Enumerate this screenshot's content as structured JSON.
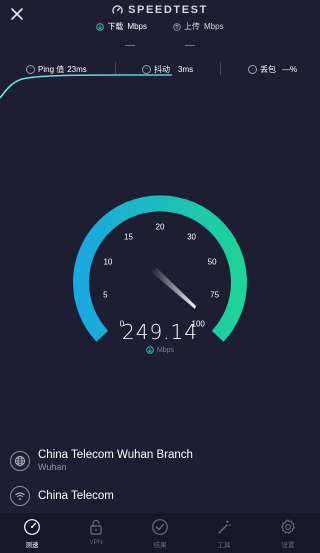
{
  "header": {
    "close_icon": "close-icon",
    "logo_text": "SPEEDTEST",
    "download_label": "下载",
    "download_unit": "Mbps",
    "upload_label": "上传",
    "upload_unit": "Mbps",
    "download_value": "—",
    "upload_value": "—"
  },
  "stats": {
    "ping_label": "Ping 值",
    "ping_value": "23ms",
    "jitter_label": "抖动",
    "jitter_value": "3ms",
    "loss_label": "丢包",
    "loss_value": "—%"
  },
  "gauge": {
    "ticks": [
      "0",
      "5",
      "10",
      "15",
      "20",
      "30",
      "50",
      "75",
      "100"
    ],
    "value": "249.14",
    "unit": "Mbps",
    "needle_value": 100,
    "gradient_start": "#1aa8e0",
    "gradient_end": "#1ed39a"
  },
  "provider": {
    "server_name": "China Telecom Wuhan Branch",
    "server_city": "Wuhan",
    "isp_name": "China Telecom"
  },
  "tabs": [
    {
      "label": "测速",
      "icon": "speedometer-icon",
      "active": true
    },
    {
      "label": "VPN",
      "icon": "lock-icon",
      "active": false
    },
    {
      "label": "结果",
      "icon": "check-circle-icon",
      "active": false
    },
    {
      "label": "工具",
      "icon": "magic-wand-icon",
      "active": false
    },
    {
      "label": "设置",
      "icon": "gear-icon",
      "active": false
    }
  ]
}
